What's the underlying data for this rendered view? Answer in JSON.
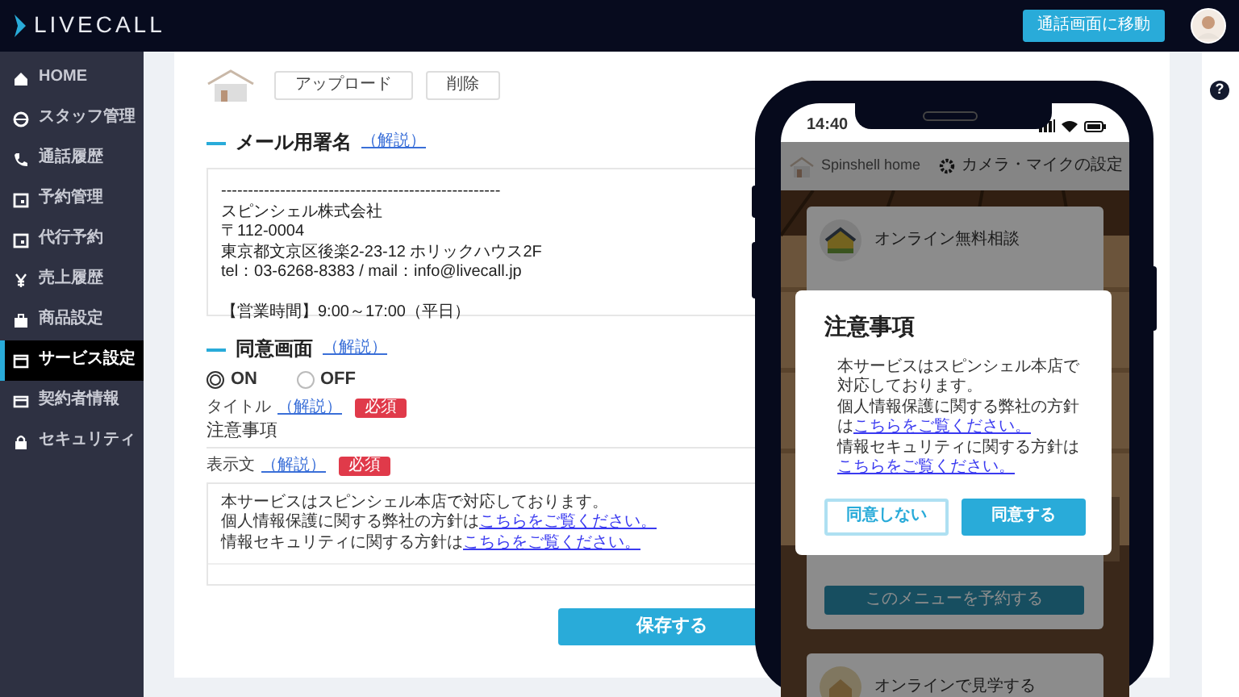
{
  "header": {
    "logo": "LIVECALL",
    "call_button": "通話画面に移動"
  },
  "sidebar": {
    "items": [
      {
        "label": "HOME",
        "selected": false
      },
      {
        "label": "スタッフ管理",
        "selected": false
      },
      {
        "label": "通話履歴",
        "selected": false
      },
      {
        "label": "予約管理",
        "selected": false
      },
      {
        "label": "代行予約",
        "selected": false
      },
      {
        "label": "売上履歴",
        "selected": false
      },
      {
        "label": "商品設定",
        "selected": false
      },
      {
        "label": "サービス設定",
        "selected": true
      },
      {
        "label": "契約者情報",
        "selected": false
      },
      {
        "label": "セキュリティ",
        "selected": false
      }
    ]
  },
  "logo_section": {
    "upload_button": "アップロード",
    "delete_button": "削除"
  },
  "signature": {
    "heading": "メール用署名",
    "help": "（解説）",
    "lines": [
      "----------------------------------------------------",
      "スピンシェル株式会社",
      "〒112-0004",
      "東京都文京区後楽2-23-12 ホリックハウス2F",
      "tel：03-6268-8383 / mail：info@livecall.jp",
      "【営業時間】9:00～17:00（平日）"
    ]
  },
  "consent": {
    "heading": "同意画面",
    "help": "（解説）",
    "options": [
      {
        "label": "ON",
        "selected": true
      },
      {
        "label": "OFF",
        "selected": false
      }
    ],
    "title_field": {
      "label": "タイトル",
      "help": "（解説）",
      "required": "必須",
      "value": "注意事項"
    },
    "body_field": {
      "label": "表示文",
      "help": "（解説）",
      "required": "必須",
      "lines": [
        {
          "text": "本サービスはスピンシェル本店で対応しております。"
        },
        {
          "text": "個人情報保護に関する弊社の方針は",
          "link": "こちらをご覧ください。"
        },
        {
          "text": "情報セキュリティに関する方針は",
          "link": "こちらをご覧ください。"
        }
      ]
    }
  },
  "save_button": "保存する",
  "help_icon": "?",
  "phone": {
    "time": "14:40",
    "site_name": "Spinshell home",
    "settings": "カメラ・マイクの設定",
    "menu_items": [
      {
        "title": "オンライン無料相談"
      },
      {
        "title": "オンラインで見学する"
      }
    ],
    "reserve_button": "このメニューを予約する",
    "modal": {
      "title": "注意事項",
      "lines": [
        {
          "text": "本サービスはスピンシェル本店で対応しております。"
        },
        {
          "text": "個人情報保護に関する弊社の方針は",
          "link": "こちらをご覧ください。"
        },
        {
          "text": "情報セキュリティに関する方針は",
          "link": "こちらをご覧ください。"
        }
      ],
      "decline_button": "同意しない",
      "accept_button": "同意する"
    }
  }
}
